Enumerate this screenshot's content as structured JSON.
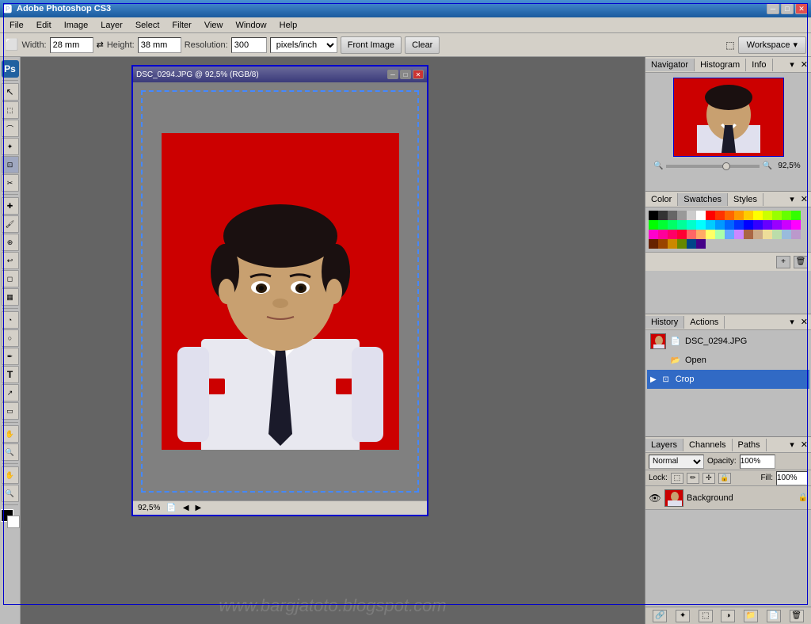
{
  "app": {
    "title": "Adobe Photoshop CS3",
    "ps_label": "Ps"
  },
  "title_bar": {
    "title": "Adobe Photoshop CS3",
    "minimize": "─",
    "maximize": "□",
    "close": "✕"
  },
  "menu": {
    "items": [
      "File",
      "Edit",
      "Image",
      "Layer",
      "Select",
      "Filter",
      "View",
      "Window",
      "Help"
    ]
  },
  "toolbar": {
    "width_label": "Width:",
    "width_value": "28 mm",
    "height_label": "Height:",
    "height_value": "38 mm",
    "resolution_label": "Resolution:",
    "resolution_value": "300",
    "resolution_unit": "pixels/inch",
    "front_image_label": "Front Image",
    "clear_label": "Clear",
    "workspace_label": "Workspace",
    "workspace_arrow": "▾"
  },
  "document": {
    "title": "DSC_0294.JPG @ 92,5% (RGB/8)",
    "zoom": "92,5%",
    "close": "✕",
    "min": "─",
    "max": "□"
  },
  "navigator": {
    "tabs": [
      "Navigator",
      "Histogram",
      "Info"
    ],
    "active_tab": "Navigator",
    "zoom_value": "92,5%"
  },
  "color_panel": {
    "tabs": [
      "Color",
      "Swatches",
      "Styles"
    ],
    "active_tab": "Swatches"
  },
  "history_panel": {
    "tabs": [
      "History",
      "Actions"
    ],
    "active_tab": "History",
    "items": [
      {
        "label": "DSC_0294.JPG",
        "type": "file"
      },
      {
        "label": "Open",
        "type": "open"
      },
      {
        "label": "Crop",
        "type": "crop",
        "active": true
      }
    ]
  },
  "layers_panel": {
    "tabs": [
      "Layers",
      "Channels",
      "Paths"
    ],
    "active_tab": "Layers",
    "blend_mode": "Normal",
    "opacity_label": "Opacity:",
    "opacity_value": "100%",
    "fill_label": "Fill:",
    "fill_value": "100%",
    "lock_label": "Lock:",
    "layers": [
      {
        "name": "Background",
        "visible": true,
        "locked": true
      }
    ]
  },
  "left_tools": [
    "↖",
    "✂",
    "⬚",
    "⬡",
    "↗",
    "✂",
    "✄",
    "🖌",
    "⬚",
    "⬛",
    "🔍",
    "✏",
    "🖋",
    "T",
    "⬚",
    "✋",
    "🔍",
    "⬚"
  ],
  "swatches": [
    "#000000",
    "#333333",
    "#666666",
    "#999999",
    "#cccccc",
    "#ffffff",
    "#ff0000",
    "#ff3300",
    "#ff6600",
    "#ff9900",
    "#ffcc00",
    "#ffff00",
    "#ccff00",
    "#99ff00",
    "#66ff00",
    "#33ff00",
    "#00ff00",
    "#00ff33",
    "#00ff66",
    "#00ff99",
    "#00ffcc",
    "#00ffff",
    "#00ccff",
    "#0099ff",
    "#0066ff",
    "#0033ff",
    "#0000ff",
    "#3300ff",
    "#6600ff",
    "#9900ff",
    "#cc00ff",
    "#ff00ff",
    "#ff00cc",
    "#ff0099",
    "#ff0066",
    "#ff0033",
    "#ff6666",
    "#ffaa66",
    "#ffff66",
    "#aaffaa",
    "#66aaff",
    "#cc88ff",
    "#aa6644",
    "#ccaa88",
    "#eedd99",
    "#bbddaa",
    "#99bbdd",
    "#bb99cc",
    "#662200",
    "#994400",
    "#cc8800",
    "#668800",
    "#004488",
    "#440088"
  ],
  "watermark": "www.bargjatoto.blogspot.com"
}
